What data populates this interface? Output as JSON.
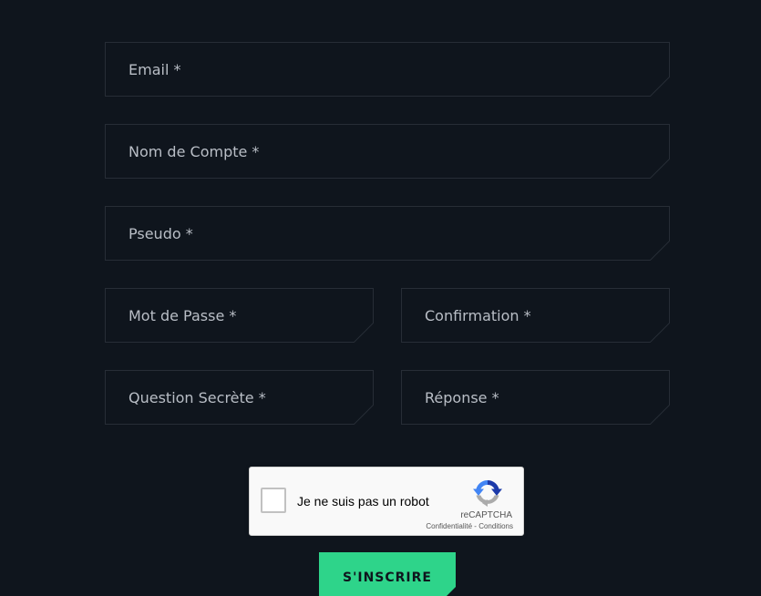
{
  "form": {
    "fields": {
      "email": {
        "placeholder": "Email *"
      },
      "account_name": {
        "placeholder": "Nom de Compte *"
      },
      "pseudo": {
        "placeholder": "Pseudo *"
      },
      "password": {
        "placeholder": "Mot de Passe *"
      },
      "confirmation": {
        "placeholder": "Confirmation *"
      },
      "secret_question": {
        "placeholder": "Question Secrète *"
      },
      "answer": {
        "placeholder": "Réponse *"
      }
    },
    "recaptcha": {
      "label": "Je ne suis pas un robot",
      "brand": "reCAPTCHA",
      "privacy": "Confidentialité",
      "separator": " - ",
      "terms": "Conditions"
    },
    "submit_label": "S'INSCRIRE"
  },
  "colors": {
    "background": "#0f151d",
    "field_border": "#272d36",
    "accent": "#2ed48a",
    "placeholder": "#b9bec6"
  },
  "icons": {
    "recaptcha_logo": "recaptcha-logo-icon"
  }
}
